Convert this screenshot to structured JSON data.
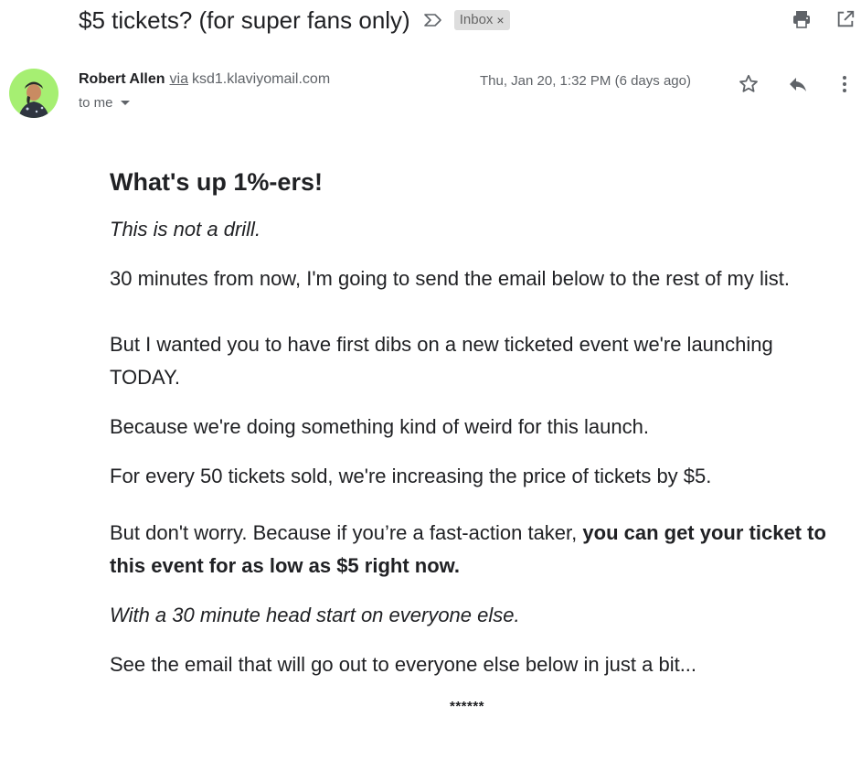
{
  "subject": "$5 tickets? (for super fans only)",
  "label_chip": {
    "label": "Inbox",
    "remove": "×"
  },
  "icons": {
    "importance": "importance-marker-icon",
    "print": "print-icon",
    "open_new_window": "open-in-new-window-icon",
    "star": "star-icon",
    "reply": "reply-icon",
    "more": "more-vert-icon"
  },
  "sender": {
    "name": "Robert Allen",
    "via_label": "via",
    "via_domain": "ksd1.klaviyomail.com",
    "to": "to me",
    "date": "Thu, Jan 20, 1:32 PM (6 days ago)"
  },
  "colors": {
    "avatar_bg": "#a6ef72",
    "chip_bg": "#dddddd",
    "text": "#202124",
    "muted": "#5f6368"
  },
  "email_body": {
    "greeting": "What's up 1%-ers!",
    "p1": "This is not a drill.",
    "p2": "30 minutes from now, I'm going to send the email below to the rest of my list.",
    "p3": "But I wanted you to have first dibs on a new ticketed event we're launching TODAY.",
    "p4": "Because we're doing something kind of weird for this launch.",
    "p5": "For every 50 tickets sold, we're increasing the price of tickets by $5.",
    "p6_normal": "But don't worry. Because if you’re a fast-action taker, ",
    "p6_bold": "you can get your ticket to this event for as low as $5 right now.",
    "p7": "With a 30 minute head start on everyone else.",
    "p8": "See the email that will go out to everyone else below in just a bit...",
    "separator": "******"
  }
}
